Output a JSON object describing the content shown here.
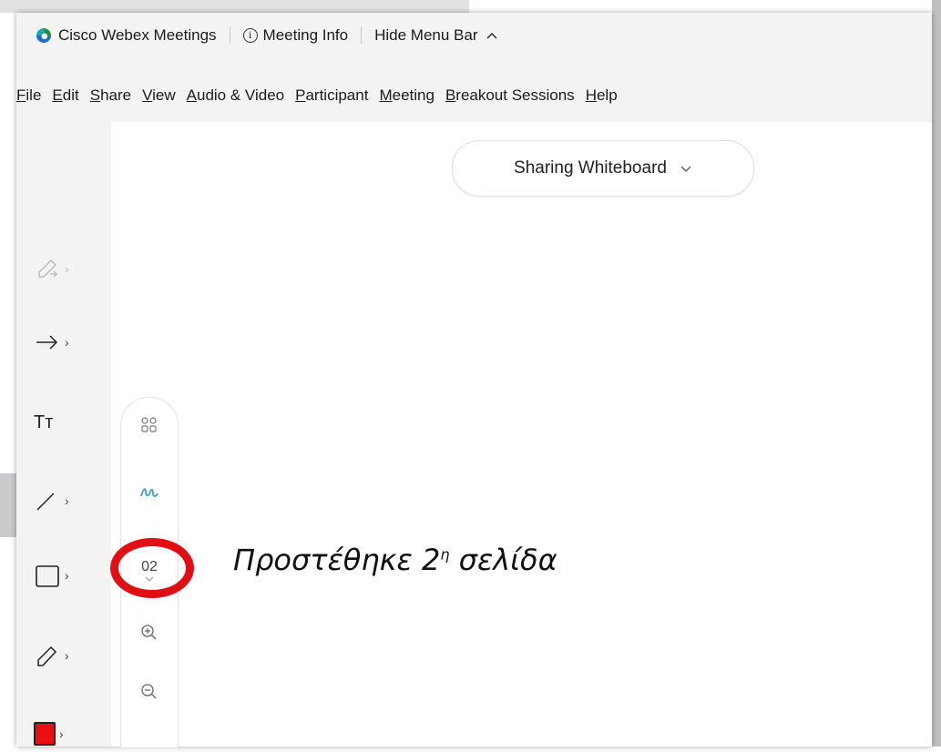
{
  "titlebar": {
    "app_name": "Cisco Webex Meetings",
    "meeting_info": "Meeting Info",
    "hide_menu_bar": "Hide Menu Bar"
  },
  "menu": [
    {
      "pre": "",
      "mnemonic": "F",
      "post": "ile"
    },
    {
      "pre": "",
      "mnemonic": "E",
      "post": "dit"
    },
    {
      "pre": "",
      "mnemonic": "S",
      "post": "hare"
    },
    {
      "pre": "",
      "mnemonic": "V",
      "post": "iew"
    },
    {
      "pre": "",
      "mnemonic": "A",
      "post": "udio & Video"
    },
    {
      "pre": "",
      "mnemonic": "P",
      "post": "articipant"
    },
    {
      "pre": "",
      "mnemonic": "M",
      "post": "eeting"
    },
    {
      "pre": "",
      "mnemonic": "B",
      "post": "reakout Sessions"
    },
    {
      "pre": "",
      "mnemonic": "H",
      "post": "elp"
    }
  ],
  "sharing": {
    "label": "Sharing Whiteboard"
  },
  "tools": [
    {
      "icon": "pen-select-icon",
      "enabled": false
    },
    {
      "icon": "arrow-icon",
      "enabled": true
    },
    {
      "icon": "text-icon",
      "enabled": true,
      "glyph": "Tт"
    },
    {
      "icon": "line-icon",
      "enabled": true
    },
    {
      "icon": "rectangle-icon",
      "enabled": true
    },
    {
      "icon": "pencil-icon",
      "enabled": true
    },
    {
      "icon": "color-swatch-icon",
      "enabled": true,
      "color": "#e81010"
    }
  ],
  "pagebar": {
    "page_number": "02"
  },
  "annotation": {
    "text_main": "Προστέθηκε 2",
    "text_sup": "η",
    "text_tail": " σελίδα",
    "ring_color": "#e10f13"
  },
  "colors": {
    "accent_blue": "#3aa0d8",
    "annotation_red": "#e10f13"
  }
}
